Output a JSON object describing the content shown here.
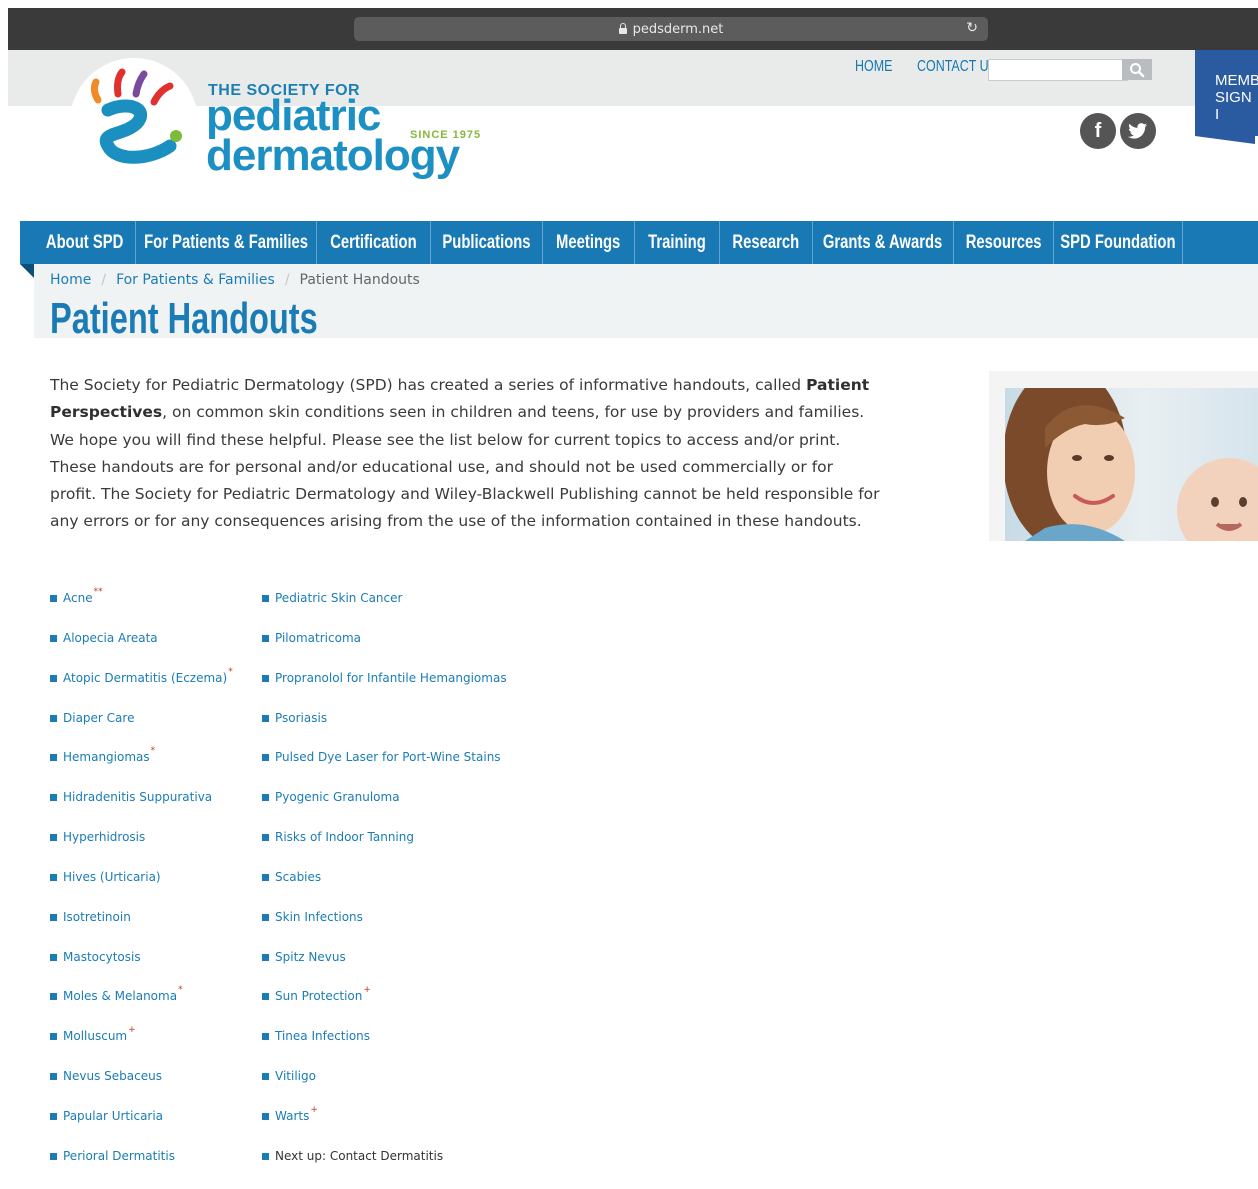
{
  "browser": {
    "url": "pedsderm.net"
  },
  "logo": {
    "line1": "THE SOCIETY FOR",
    "line2": "pediatric",
    "line3": "dermatology",
    "since": "SINCE 1975"
  },
  "header": {
    "links": [
      "HOME",
      "CONTACT US"
    ],
    "search_placeholder": "",
    "member_tab": [
      "MEMBE",
      "SIGN I"
    ]
  },
  "social": {
    "facebook": "f",
    "twitter": "t"
  },
  "nav": [
    "About SPD",
    "For Patients & Families",
    "Certification",
    "Publications",
    "Meetings",
    "Training",
    "Research",
    "Grants & Awards",
    "Resources",
    "SPD Foundation"
  ],
  "breadcrumb": {
    "home": "Home",
    "section": "For Patients & Families",
    "current": "Patient Handouts"
  },
  "page_title": "Patient Handouts",
  "intro": {
    "part1": "The Society for Pediatric Dermatology (SPD) has created a series of informative handouts, called ",
    "bold": "Patient Perspectives",
    "part2": ", on common skin conditions seen in children and teens, for use by providers and families. We hope you will find these helpful. Please see the list below for current topics to access and/or print. These handouts are for personal and/or educational use, and should not be used commercially or for profit. The Society for Pediatric Dermatology and Wiley-Blackwell Publishing cannot be held responsible for any errors or for any consequences arising from the use of the information contained in these handouts."
  },
  "handouts_left": [
    {
      "label": "Acne",
      "mark": "**"
    },
    {
      "label": "Alopecia Areata",
      "mark": ""
    },
    {
      "label": "Atopic Dermatitis (Eczema)",
      "mark": "*"
    },
    {
      "label": "Diaper Care",
      "mark": ""
    },
    {
      "label": "Hemangiomas",
      "mark": "*"
    },
    {
      "label": "Hidradenitis Suppurativa",
      "mark": ""
    },
    {
      "label": "Hyperhidrosis",
      "mark": ""
    },
    {
      "label": "Hives (Urticaria)",
      "mark": ""
    },
    {
      "label": "Isotretinoin",
      "mark": ""
    },
    {
      "label": "Mastocytosis",
      "mark": ""
    },
    {
      "label": "Moles & Melanoma",
      "mark": "*"
    },
    {
      "label": "Molluscum",
      "mark": "+"
    },
    {
      "label": "Nevus Sebaceus",
      "mark": ""
    },
    {
      "label": "Papular Urticaria",
      "mark": ""
    },
    {
      "label": "Perioral Dermatitis",
      "mark": ""
    }
  ],
  "handouts_right": [
    {
      "label": "Pediatric Skin Cancer",
      "mark": ""
    },
    {
      "label": "Pilomatricoma",
      "mark": ""
    },
    {
      "label": "Propranolol for Infantile Hemangiomas",
      "mark": ""
    },
    {
      "label": "Psoriasis",
      "mark": ""
    },
    {
      "label": "Pulsed Dye Laser for Port-Wine Stains",
      "mark": ""
    },
    {
      "label": "Pyogenic Granuloma",
      "mark": ""
    },
    {
      "label": "Risks of Indoor Tanning",
      "mark": ""
    },
    {
      "label": "Scabies",
      "mark": ""
    },
    {
      "label": "Skin Infections",
      "mark": ""
    },
    {
      "label": "Spitz Nevus",
      "mark": ""
    },
    {
      "label": "Sun Protection",
      "mark": "+"
    },
    {
      "label": "Tinea Infections",
      "mark": ""
    },
    {
      "label": "Vitiligo",
      "mark": ""
    },
    {
      "label": "Warts",
      "mark": "+"
    },
    {
      "label": "Next up: Contact Dermatitis",
      "mark": "",
      "plain": true
    }
  ],
  "colors": {
    "brand": "#1b7cb5",
    "nav": "#1979b5",
    "accent_green": "#86b83d",
    "member_tab": "#2a5aa0"
  }
}
